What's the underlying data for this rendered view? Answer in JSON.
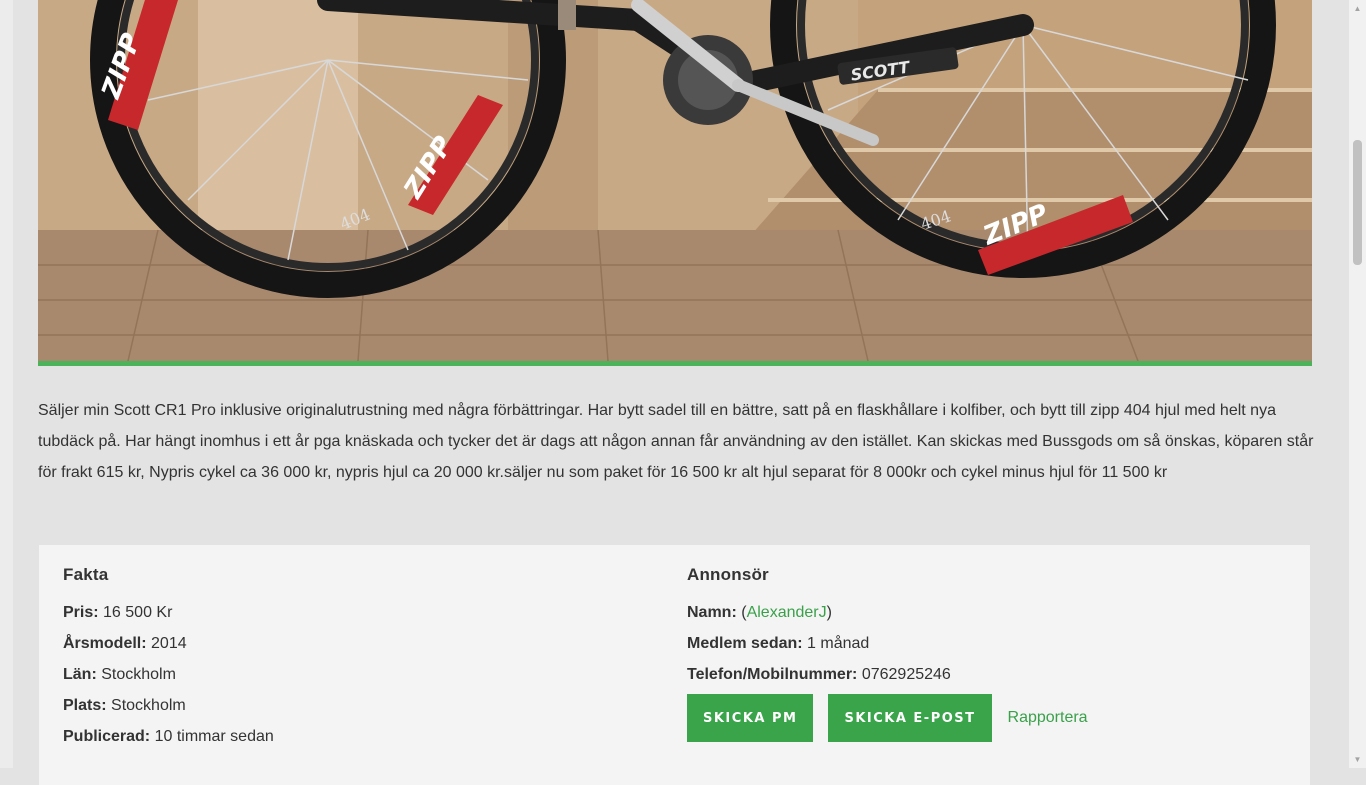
{
  "description": "Säljer min Scott CR1 Pro inklusive originalutrustning med några förbättringar. Har bytt sadel till en bättre, satt på en flaskhållare i kolfiber, och bytt till zipp 404 hjul med helt nya tubdäck på. Har hängt inomhus i ett år pga knäskada och tycker det är dags att någon annan får användning av den istället. Kan skickas med Bussgods om så önskas, köparen står för frakt 615 kr, Nypris cykel ca 36 000 kr, nypris hjul ca 20 000 kr.säljer nu som paket för 16 500 kr alt hjul separat för 8 000kr och cykel minus hjul för 11 500 kr",
  "facts": {
    "heading": "Fakta",
    "price_label": "Pris:",
    "price_value": "16 500 Kr",
    "year_label": "Årsmodell:",
    "year_value": "2014",
    "county_label": "Län:",
    "county_value": "Stockholm",
    "place_label": "Plats:",
    "place_value": "Stockholm",
    "published_label": "Publicerad:",
    "published_value": "10 timmar sedan"
  },
  "advertiser": {
    "heading": "Annonsör",
    "name_label": "Namn:",
    "name_open": "(",
    "name_value": "AlexanderJ",
    "name_close": ")",
    "member_label": "Medlem sedan:",
    "member_value": "1 månad",
    "phone_label": "Telefon/Mobilnummer:",
    "phone_value": "0762925246",
    "pm_button": "SKICKA PM",
    "email_button": "SKICKA E-POST",
    "report_link": "Rapportera"
  },
  "photo": {
    "frame_text": "SCOTT",
    "rim_text": "ZIPP",
    "rim_model": "404"
  },
  "colors": {
    "accent": "#3aa44b",
    "link": "#3aa14a",
    "photo_bar": "#4cb35a"
  }
}
